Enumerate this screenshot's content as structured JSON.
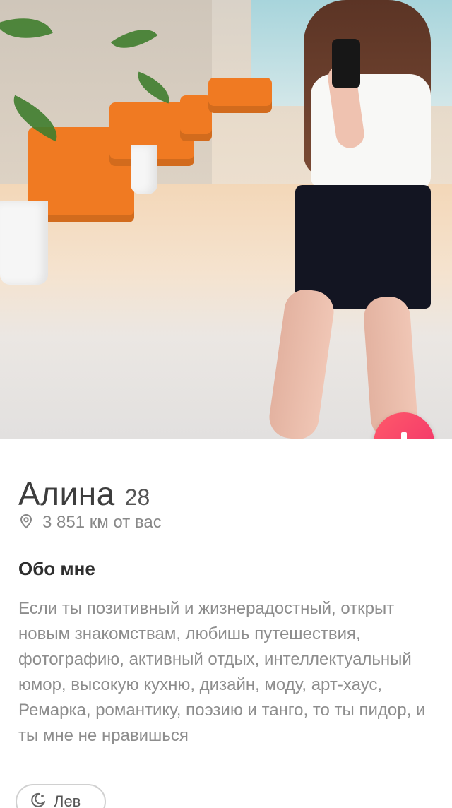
{
  "profile": {
    "name": "Алина",
    "age": "28",
    "distance": "3 851 км от вас"
  },
  "about": {
    "title": "Обо мне",
    "text": "Если ты позитивный и жизнерадостный, открыт новым знакомствам, любишь путешествия, фотографию, активный отдых, интеллектуальный юмор, высокую кухню, дизайн, моду, арт-хаус, Ремарка, романтику, поэзию и танго, то ты пидор, и ты мне не нравишься"
  },
  "chips": {
    "zodiac": "Лев"
  },
  "icons": {
    "info_button": "arrow-down-icon",
    "location": "location-pin-icon",
    "zodiac": "moon-icon"
  },
  "colors": {
    "accent": "#f0306a"
  }
}
